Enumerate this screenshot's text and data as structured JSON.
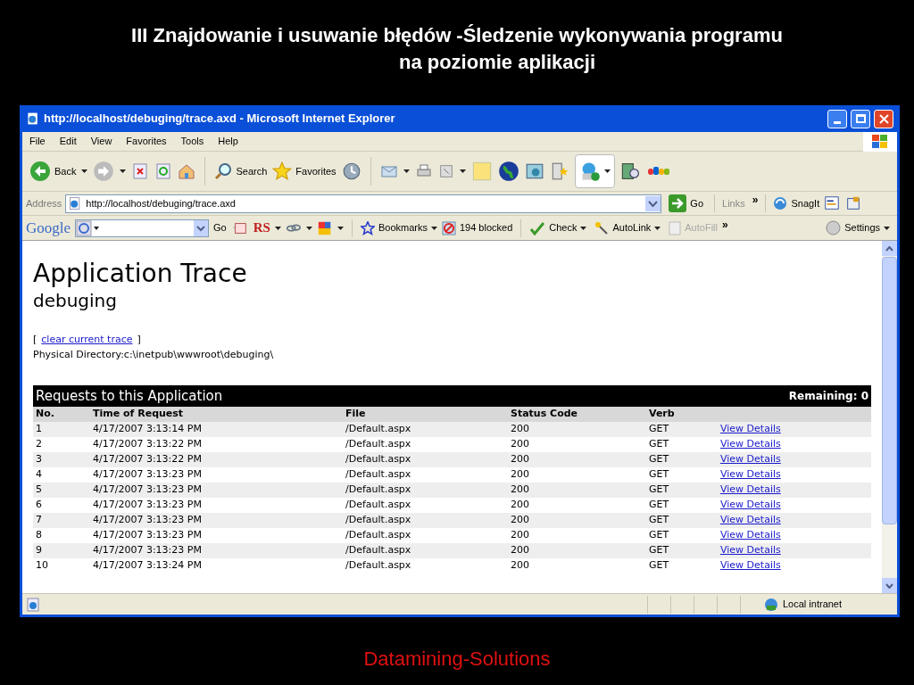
{
  "slide": {
    "title_lines": [
      "III Znajdowanie i usuwanie błędów -Śledzenie wykonywania programu",
      "na poziomie aplikacji"
    ],
    "footer": "Datamining-Solutions"
  },
  "window": {
    "title": "http://localhost/debuging/trace.axd - Microsoft Internet Explorer"
  },
  "menu": [
    "File",
    "Edit",
    "View",
    "Favorites",
    "Tools",
    "Help"
  ],
  "toolbar": {
    "back": "Back",
    "search": "Search",
    "favorites": "Favorites"
  },
  "address_bar": {
    "label": "Address",
    "value": "http://localhost/debuging/trace.axd",
    "go": "Go",
    "links": "Links",
    "links_more": "»",
    "snagit": "SnagIt"
  },
  "google_bar": {
    "logo": "Google",
    "go": "Go",
    "rs": "RS",
    "bookmarks": "Bookmarks",
    "blocked": "194 blocked",
    "check": "Check",
    "autolink": "AutoLink",
    "autofill": {
      "label": "AutoFill",
      "disabled": true
    },
    "more": "»",
    "settings": "Settings"
  },
  "page": {
    "heading": "Application Trace",
    "subheading": "debuging",
    "bracket_open": "[",
    "clear_link": "clear current trace",
    "bracket_close": "]",
    "physical_directory": "Physical Directory:c:\\inetpub\\wwwroot\\debuging\\"
  },
  "table": {
    "title": "Requests to this Application",
    "remaining": "Remaining: 0",
    "columns": [
      "No.",
      "Time of Request",
      "File",
      "Status Code",
      "Verb"
    ],
    "rows": [
      {
        "no": "1",
        "time": "4/17/2007 3:13:14 PM",
        "file": "/Default.aspx",
        "status": "200",
        "verb": "GET",
        "link": "View Details"
      },
      {
        "no": "2",
        "time": "4/17/2007 3:13:22 PM",
        "file": "/Default.aspx",
        "status": "200",
        "verb": "GET",
        "link": "View Details"
      },
      {
        "no": "3",
        "time": "4/17/2007 3:13:22 PM",
        "file": "/Default.aspx",
        "status": "200",
        "verb": "GET",
        "link": "View Details"
      },
      {
        "no": "4",
        "time": "4/17/2007 3:13:23 PM",
        "file": "/Default.aspx",
        "status": "200",
        "verb": "GET",
        "link": "View Details"
      },
      {
        "no": "5",
        "time": "4/17/2007 3:13:23 PM",
        "file": "/Default.aspx",
        "status": "200",
        "verb": "GET",
        "link": "View Details"
      },
      {
        "no": "6",
        "time": "4/17/2007 3:13:23 PM",
        "file": "/Default.aspx",
        "status": "200",
        "verb": "GET",
        "link": "View Details"
      },
      {
        "no": "7",
        "time": "4/17/2007 3:13:23 PM",
        "file": "/Default.aspx",
        "status": "200",
        "verb": "GET",
        "link": "View Details"
      },
      {
        "no": "8",
        "time": "4/17/2007 3:13:23 PM",
        "file": "/Default.aspx",
        "status": "200",
        "verb": "GET",
        "link": "View Details"
      },
      {
        "no": "9",
        "time": "4/17/2007 3:13:23 PM",
        "file": "/Default.aspx",
        "status": "200",
        "verb": "GET",
        "link": "View Details"
      },
      {
        "no": "10",
        "time": "4/17/2007 3:13:24 PM",
        "file": "/Default.aspx",
        "status": "200",
        "verb": "GET",
        "link": "View Details"
      }
    ]
  },
  "status_bar": {
    "zone": "Local intranet"
  }
}
